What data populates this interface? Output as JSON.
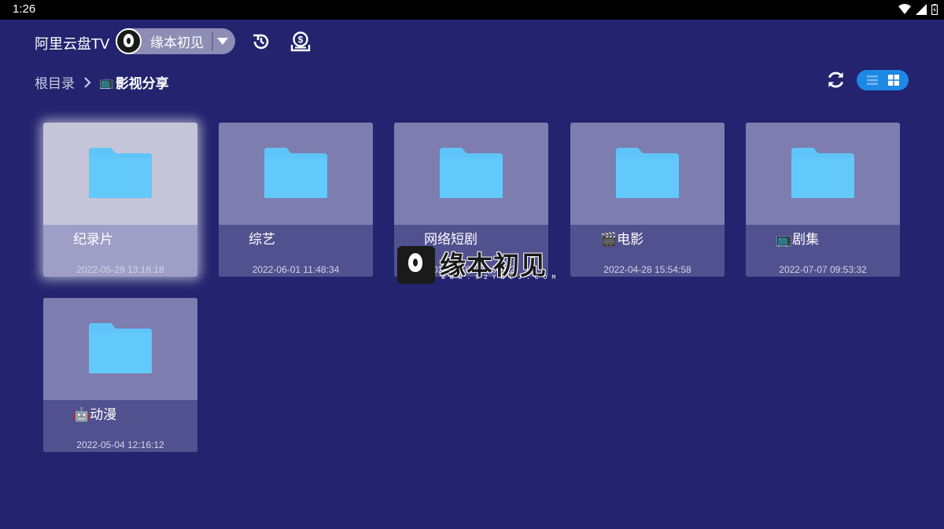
{
  "status_bar": {
    "time": "1:26"
  },
  "header": {
    "app_title": "阿里云盘TV",
    "account_name": "缘本初见",
    "icons": [
      "history-icon",
      "money-bag-icon"
    ]
  },
  "breadcrumb": {
    "root": "根目录",
    "current_emoji": "📺",
    "current": "影视分享"
  },
  "toolbar": {
    "refresh_icon": "refresh-icon",
    "view_modes": [
      "list",
      "grid"
    ],
    "active_view": "grid"
  },
  "folders": [
    {
      "emoji": "",
      "name": "纪录片",
      "date": "2022-05-29 13:18:18",
      "focused": true
    },
    {
      "emoji": "",
      "name": "综艺",
      "date": "2022-06-01 11:48:34",
      "focused": false
    },
    {
      "emoji": "",
      "name": "网络短剧",
      "date": "2022-07-04 14:01:12",
      "focused": false
    },
    {
      "emoji": "🎬",
      "name": "电影",
      "date": "2022-04-28 15:54:58",
      "focused": false
    },
    {
      "emoji": "📺",
      "name": "剧集",
      "date": "2022-07-07 09:53:32",
      "focused": false
    },
    {
      "emoji": "🤖",
      "name": "动漫",
      "date": "2022-05-04 12:16:12",
      "focused": false
    }
  ],
  "watermark": {
    "text": "缘本初见",
    "url": "WWW.52YBCJ.COM"
  },
  "colors": {
    "background": "#23236f",
    "accent": "#1e88e5",
    "folder": "#5fc4f8"
  }
}
